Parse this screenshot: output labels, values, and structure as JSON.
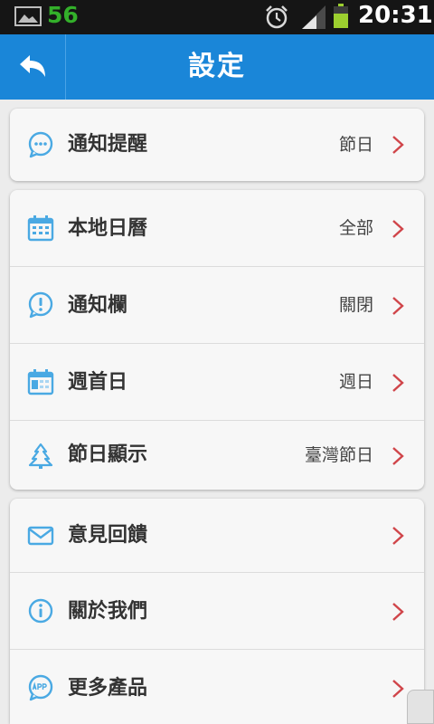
{
  "status_bar": {
    "notification_count": "56",
    "time": "20:31"
  },
  "header": {
    "title": "設定"
  },
  "sections": [
    {
      "rows": [
        {
          "label": "通知提醒",
          "value": "節日",
          "icon": "chat-bubble-icon"
        }
      ]
    },
    {
      "rows": [
        {
          "label": "本地日曆",
          "value": "全部",
          "icon": "calendar-icon"
        },
        {
          "label": "通知欄",
          "value": "關閉",
          "icon": "exclamation-icon"
        },
        {
          "label": "週首日",
          "value": "週日",
          "icon": "calendar-week-icon"
        },
        {
          "label": "節日顯示",
          "value": "臺灣節日",
          "icon": "tree-icon"
        }
      ]
    },
    {
      "rows": [
        {
          "label": "意見回饋",
          "value": "",
          "icon": "mail-icon"
        },
        {
          "label": "關於我們",
          "value": "",
          "icon": "info-icon"
        },
        {
          "label": "更多產品",
          "value": "",
          "icon": "app-icon"
        }
      ]
    }
  ],
  "colors": {
    "header_bg": "#1a86d8",
    "icon_blue": "#4aa9e3",
    "chevron_red": "#d0454a",
    "status_green": "#33b02a"
  }
}
